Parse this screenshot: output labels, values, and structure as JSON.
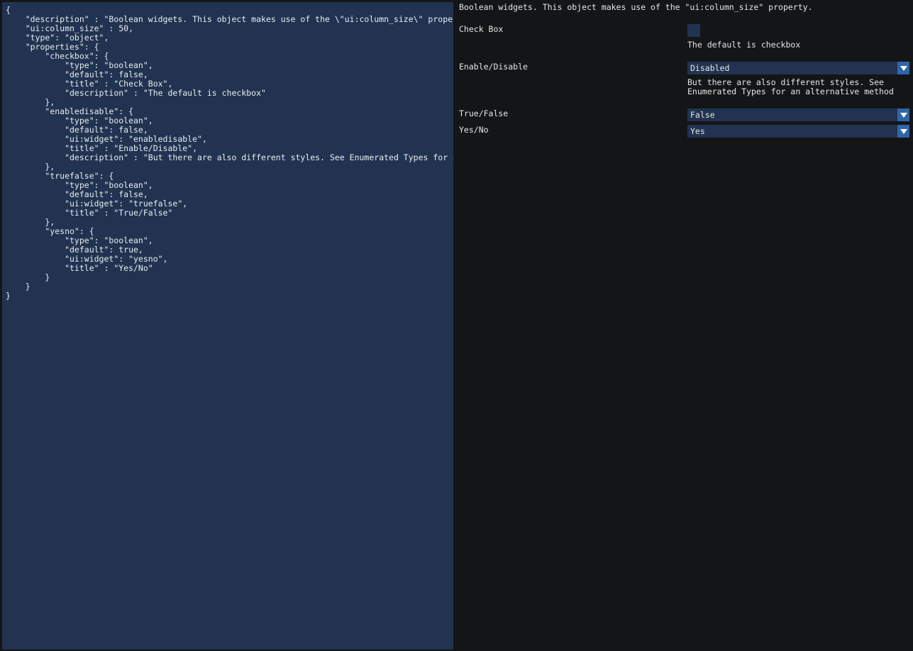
{
  "editor": {
    "content": "{\n    \"description\" : \"Boolean widgets. This object makes use of the \\\"ui:column_size\\\" property.\",\n    \"ui:column_size\" : 50,\n    \"type\": \"object\",\n    \"properties\": {\n        \"checkbox\": {\n            \"type\": \"boolean\",\n            \"default\": false,\n            \"title\" : \"Check Box\",\n            \"description\" : \"The default is checkbox\"\n        },\n        \"enabledisable\": {\n            \"type\": \"boolean\",\n            \"default\": false,\n            \"ui:widget\": \"enabledisable\",\n            \"title\" : \"Enable/Disable\",\n            \"description\" : \"But there are also different styles. See Enumerated Types for an alternative method\"\n        },\n        \"truefalse\": {\n            \"type\": \"boolean\",\n            \"default\": false,\n            \"ui:widget\": \"truefalse\",\n            \"title\" : \"True/False\"\n        },\n        \"yesno\": {\n            \"type\": \"boolean\",\n            \"default\": true,\n            \"ui:widget\": \"yesno\",\n            \"title\" : \"Yes/No\"\n        }\n    }\n}"
  },
  "form": {
    "description": "Boolean widgets. This object makes use of the \"ui:column_size\" property.",
    "checkbox": {
      "label": "Check Box",
      "help": "The default is checkbox"
    },
    "enabledisable": {
      "label": "Enable/Disable",
      "value": "Disabled",
      "help": "But there are also different styles. See\nEnumerated Types for an alternative method"
    },
    "truefalse": {
      "label": "True/False",
      "value": "False"
    },
    "yesno": {
      "label": "Yes/No",
      "value": "Yes"
    }
  },
  "colors": {
    "background": "#141517",
    "panel": "#213350",
    "accent": "#3165a9",
    "text": "#e6e6e6"
  }
}
